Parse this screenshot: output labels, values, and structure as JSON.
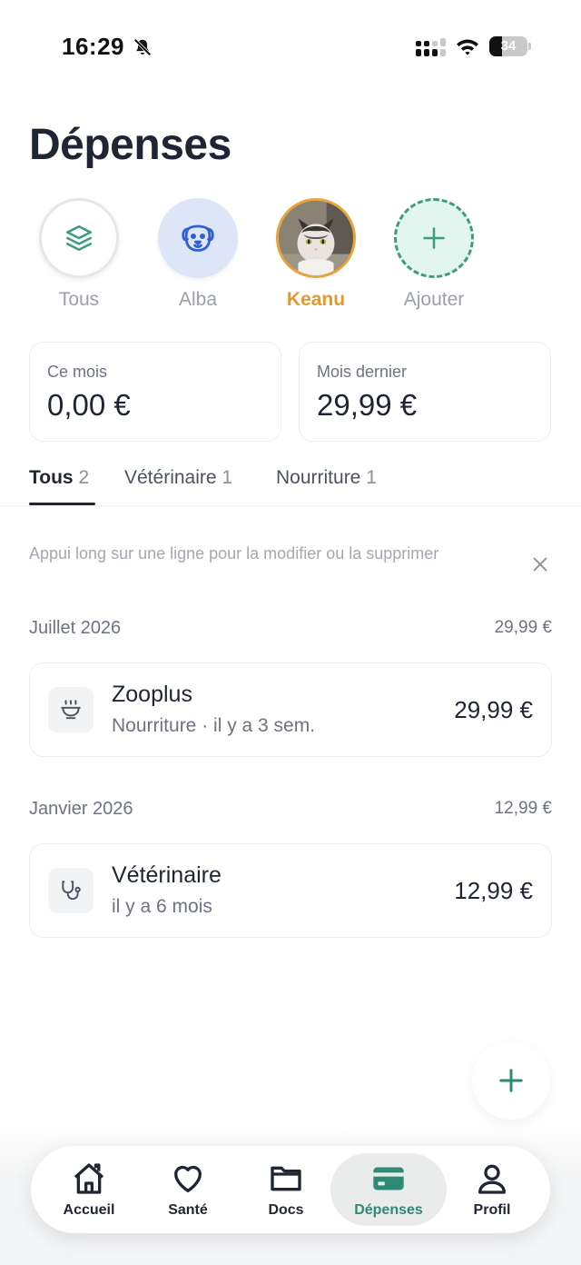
{
  "status_bar": {
    "time": "16:29",
    "battery": "34",
    "battery_fraction": 0.34
  },
  "page_title": "Dépenses",
  "pets": [
    {
      "label": "Tous",
      "icon": "layers-icon",
      "selected": false
    },
    {
      "label": "Alba",
      "icon": "dog-face-icon",
      "selected": false
    },
    {
      "label": "Keanu",
      "icon": "cat-photo",
      "selected": true
    },
    {
      "label": "Ajouter",
      "icon": "plus-icon",
      "selected": false
    }
  ],
  "summary": {
    "this_month_label": "Ce mois",
    "this_month_value": "0,00 €",
    "last_month_label": "Mois dernier",
    "last_month_value": "29,99 €"
  },
  "tabs": [
    {
      "label": "Tous",
      "count": "2",
      "active": true
    },
    {
      "label": "Vétérinaire",
      "count": "1",
      "active": false
    },
    {
      "label": "Nourriture",
      "count": "1",
      "active": false
    }
  ],
  "hint": "Appui long sur une ligne pour la modifier ou la supprimer",
  "groups": [
    {
      "title": "Juillet 2026",
      "total": "29,99 €",
      "items": [
        {
          "name": "Zooplus",
          "subtitle": "Nourriture · il y a 3 sem.",
          "amount": "29,99 €",
          "icon": "food-bowl-icon"
        }
      ]
    },
    {
      "title": "Janvier 2026",
      "total": "12,99 €",
      "items": [
        {
          "name": "Vétérinaire",
          "subtitle": "il y a 6 mois",
          "amount": "12,99 €",
          "icon": "stethoscope-icon"
        }
      ]
    }
  ],
  "nav": [
    {
      "label": "Accueil",
      "icon": "home-icon",
      "active": false
    },
    {
      "label": "Santé",
      "icon": "heart-icon",
      "active": false
    },
    {
      "label": "Docs",
      "icon": "folder-icon",
      "active": false
    },
    {
      "label": "Dépenses",
      "icon": "card-icon",
      "active": true
    },
    {
      "label": "Profil",
      "icon": "user-icon",
      "active": false
    }
  ],
  "colors": {
    "accent": "#2f8a74",
    "selected_pet": "#e39a2d",
    "text": "#1f2533"
  }
}
